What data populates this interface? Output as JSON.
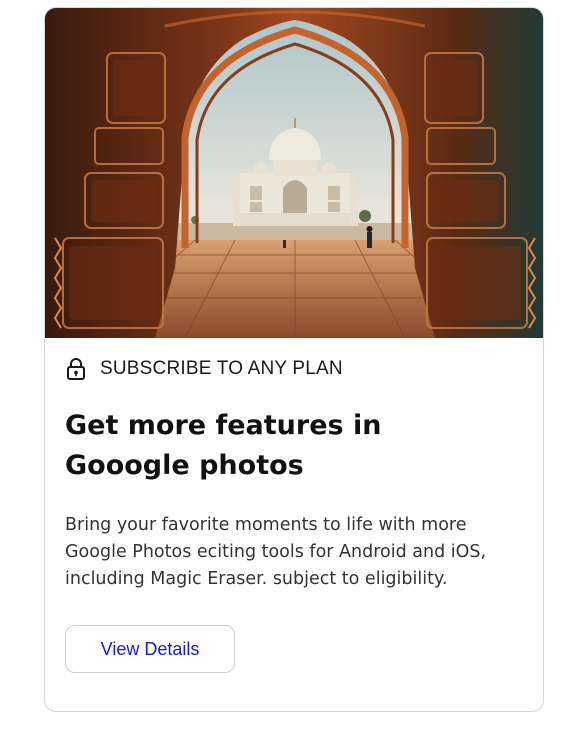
{
  "card": {
    "hero_image_alt": "",
    "badge": {
      "icon": "lock-icon",
      "label": "SUBSCRIBE TO ANY PLAN"
    },
    "title": "Get more features in Gooogle photos",
    "description": "Bring your favorite moments to life with more Google Photos eciting tools for Android and iOS, including Magic Eraser. subject to eligibility.",
    "button_label": "View Details"
  },
  "colors": {
    "button_text": "#1a1ad0",
    "card_border": "#d6d6d6",
    "title_text": "#111111",
    "body_text": "#333333"
  }
}
